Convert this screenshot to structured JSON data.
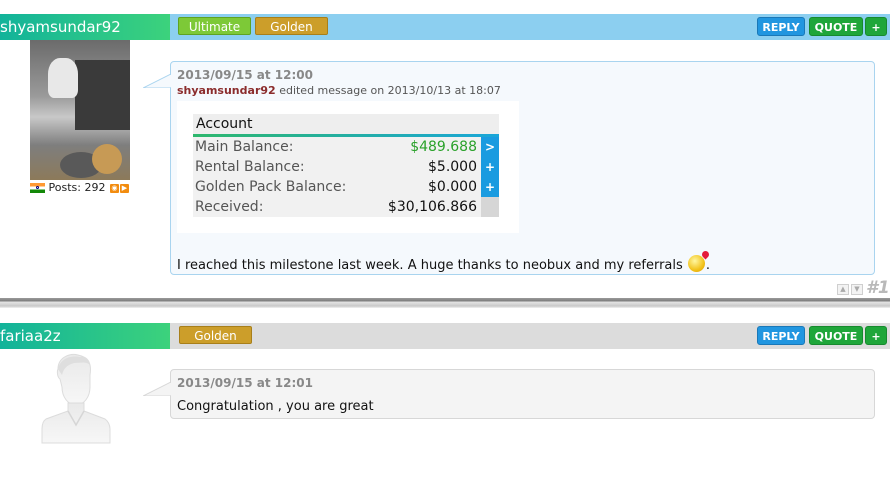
{
  "posts": [
    {
      "username": "shyamsundar92",
      "badges": [
        "Ultimate",
        "Golden"
      ],
      "actions": {
        "reply": "REPLY",
        "quote": "QUOTE",
        "plus": "+"
      },
      "meta": {
        "posts_label": "Posts: 292"
      },
      "date": "2013/09/15 at 12:00",
      "edit": {
        "user": "shyamsundar92",
        "text": "edited message on 2013/10/13 at 18:07"
      },
      "widget": {
        "title": "Account",
        "rows": [
          {
            "label": "Main Balance:",
            "value": "$489.688",
            "button": ">"
          },
          {
            "label": "Rental Balance:",
            "value": "$5.000",
            "button": "+"
          },
          {
            "label": "Golden Pack Balance:",
            "value": "$0.000",
            "button": "+"
          },
          {
            "label": "Received:",
            "value": "$30,106.866",
            "button": ""
          }
        ]
      },
      "message_before": "I reached this milestone last week. A huge thanks to neobux and my referrals ",
      "message_after": ".",
      "post_number": "#1"
    },
    {
      "username": "fariaa2z",
      "badges": [
        "Golden"
      ],
      "actions": {
        "reply": "REPLY",
        "quote": "QUOTE",
        "plus": "+"
      },
      "date": "2013/09/15 at 12:01",
      "message": "Congratulation , you are great"
    }
  ],
  "colors": {
    "accent_green": "#2aa12a",
    "reply_blue": "#2196e0",
    "quote_green": "#1fa63a",
    "golden": "#cc9e2a"
  },
  "icons": [
    "india-flag-icon",
    "rss-icon",
    "play-icon",
    "smiley-icon",
    "default-avatar-icon",
    "vote-up-icon",
    "vote-down-icon"
  ]
}
